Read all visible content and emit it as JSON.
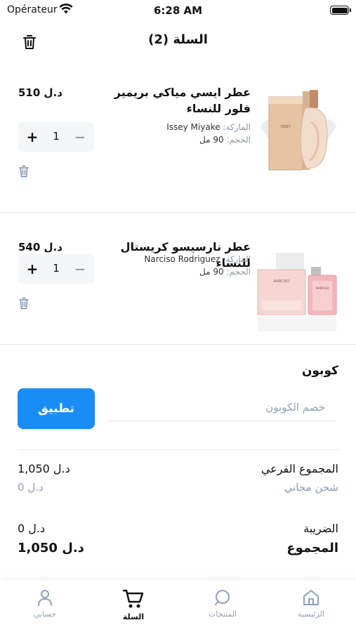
{
  "status_bar": {
    "carrier": "Opérateur",
    "time": "6:28 AM"
  },
  "header": {
    "title": "السلة (2)"
  },
  "cart_items": [
    {
      "title": "عطر ايسي مياكي بريمير فلور للنساء",
      "price": "د.ل 510",
      "brand_label": "الماركة:",
      "brand": "Issey Miyake",
      "size_label": "الحجم:",
      "size": "90 مل",
      "quantity": "1"
    },
    {
      "title": "عطر نارسيسو كريستال للنساء",
      "price": "د.ل 540",
      "brand_label": "الماركة:",
      "brand": "Narciso Rodriguez",
      "size_label": "الحجم:",
      "size": "90 مل",
      "quantity": "1"
    }
  ],
  "coupon": {
    "label": "كوبون",
    "placeholder": "خصم الكوبون",
    "apply_label": "تطبيق"
  },
  "summary": {
    "subtotal_label": "المجموع الفرعي",
    "subtotal_value": "د.ل 1,050",
    "shipping_label": "شحن مجاني",
    "shipping_value": "د.ل 0",
    "tax_label": "الضريبة",
    "tax_value": "د.ل 0",
    "total_label": "المجموع",
    "total_value": "د.ل 1,050"
  },
  "tabbar": {
    "items": [
      {
        "label": "حسابي",
        "icon": "person-icon"
      },
      {
        "label": "السلة",
        "icon": "cart-icon",
        "active": true
      },
      {
        "label": "المنتجات",
        "icon": "search-icon"
      },
      {
        "label": "الرئيسية",
        "icon": "home-icon"
      }
    ]
  },
  "colors": {
    "accent": "#1a8cf5",
    "muted_text": "#8fa0ba",
    "qty_bg": "#f4f5f7"
  }
}
